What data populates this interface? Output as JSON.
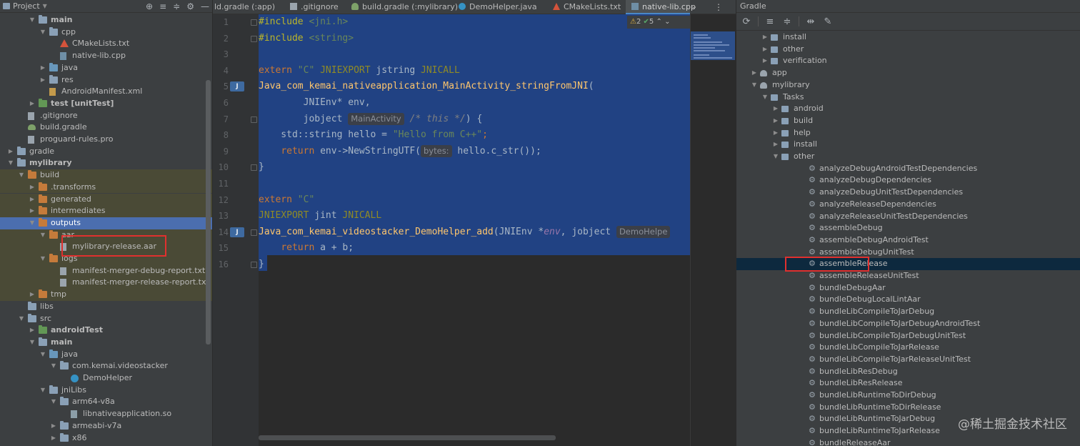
{
  "project_panel": {
    "title": "Project",
    "tools": [
      "target-icon",
      "expand-all-icon",
      "collapse-all-icon",
      "gear-icon",
      "hide-icon"
    ],
    "tree": [
      {
        "label": "main",
        "level": 3,
        "arrow": "down",
        "icon": "folder",
        "bold": true
      },
      {
        "label": "cpp",
        "level": 4,
        "arrow": "down",
        "icon": "folder"
      },
      {
        "label": "CMakeLists.txt",
        "level": 5,
        "arrow": "",
        "icon": "cmake"
      },
      {
        "label": "native-lib.cpp",
        "level": 5,
        "arrow": "",
        "icon": "cpp"
      },
      {
        "label": "java",
        "level": 4,
        "arrow": "right",
        "icon": "folder-blue"
      },
      {
        "label": "res",
        "level": 4,
        "arrow": "right",
        "icon": "folder"
      },
      {
        "label": "AndroidManifest.xml",
        "level": 4,
        "arrow": "",
        "icon": "xml"
      },
      {
        "label": "test [unitTest]",
        "level": 3,
        "arrow": "right",
        "icon": "folder-green",
        "bold": true
      },
      {
        "label": ".gitignore",
        "level": 2,
        "arrow": "",
        "icon": "doc"
      },
      {
        "label": "build.gradle",
        "level": 2,
        "arrow": "",
        "icon": "gradle"
      },
      {
        "label": "proguard-rules.pro",
        "level": 2,
        "arrow": "",
        "icon": "doc"
      },
      {
        "label": "gradle",
        "level": 1,
        "arrow": "right",
        "icon": "folder"
      },
      {
        "label": "mylibrary",
        "level": 1,
        "arrow": "down",
        "icon": "folder",
        "bold": true
      },
      {
        "label": "build",
        "level": 2,
        "arrow": "down",
        "icon": "folder-orange",
        "hl": "olive"
      },
      {
        "label": ".transforms",
        "level": 3,
        "arrow": "right",
        "icon": "folder-orange",
        "hl": "olive"
      },
      {
        "label": "generated",
        "level": 3,
        "arrow": "right",
        "icon": "folder-orange",
        "hl": "olive"
      },
      {
        "label": "intermediates",
        "level": 3,
        "arrow": "right",
        "icon": "folder-orange",
        "hl": "olive"
      },
      {
        "label": "outputs",
        "level": 3,
        "arrow": "down",
        "icon": "folder-orange",
        "hl": "selected"
      },
      {
        "label": "aar",
        "level": 4,
        "arrow": "down",
        "icon": "folder-orange",
        "hl": "olive"
      },
      {
        "label": "mylibrary-release.aar",
        "level": 5,
        "arrow": "",
        "icon": "aar",
        "hl": "olive"
      },
      {
        "label": "logs",
        "level": 4,
        "arrow": "down",
        "icon": "folder-orange",
        "hl": "olive"
      },
      {
        "label": "manifest-merger-debug-report.txt",
        "level": 5,
        "arrow": "",
        "icon": "doc",
        "hl": "olive"
      },
      {
        "label": "manifest-merger-release-report.txt",
        "level": 5,
        "arrow": "",
        "icon": "doc",
        "hl": "olive"
      },
      {
        "label": "tmp",
        "level": 3,
        "arrow": "right",
        "icon": "folder-orange",
        "hl": "olive"
      },
      {
        "label": "libs",
        "level": 2,
        "arrow": "",
        "icon": "folder"
      },
      {
        "label": "src",
        "level": 2,
        "arrow": "down",
        "icon": "folder"
      },
      {
        "label": "androidTest",
        "level": 3,
        "arrow": "right",
        "icon": "folder-green",
        "bold": true
      },
      {
        "label": "main",
        "level": 3,
        "arrow": "down",
        "icon": "folder",
        "bold": true
      },
      {
        "label": "java",
        "level": 4,
        "arrow": "down",
        "icon": "folder-blue"
      },
      {
        "label": "com.kemai.videostacker",
        "level": 5,
        "arrow": "down",
        "icon": "folder"
      },
      {
        "label": "DemoHelper",
        "level": 6,
        "arrow": "",
        "icon": "class"
      },
      {
        "label": "jniLibs",
        "level": 4,
        "arrow": "down",
        "icon": "folder"
      },
      {
        "label": "arm64-v8a",
        "level": 5,
        "arrow": "down",
        "icon": "folder"
      },
      {
        "label": "libnativeapplication.so",
        "level": 6,
        "arrow": "",
        "icon": "so"
      },
      {
        "label": "armeabi-v7a",
        "level": 5,
        "arrow": "right",
        "icon": "folder"
      },
      {
        "label": "x86",
        "level": 5,
        "arrow": "right",
        "icon": "folder"
      }
    ]
  },
  "editor": {
    "tabs": [
      {
        "label": "ld.gradle (:app)",
        "icon": "gradle",
        "active": false
      },
      {
        "label": ".gitignore",
        "icon": "git",
        "active": false
      },
      {
        "label": "build.gradle (:mylibrary)",
        "icon": "gradle",
        "active": false
      },
      {
        "label": "DemoHelper.java",
        "icon": "java",
        "active": false
      },
      {
        "label": "CMakeLists.txt",
        "icon": "cmake",
        "active": false
      },
      {
        "label": "native-lib.cpp",
        "icon": "cpp",
        "active": true
      }
    ],
    "tab_dropdown": "⌄",
    "tab_menu": "⋮",
    "inspection": {
      "warnings": "2",
      "ok": "5",
      "up": "⌃",
      "down": "⌄"
    },
    "line_numbers": [
      "1",
      "2",
      "3",
      "4",
      "5",
      "6",
      "7",
      "8",
      "9",
      "10",
      "11",
      "12",
      "13",
      "14",
      "15",
      "16"
    ],
    "gutter_icon_text": "J",
    "code": {
      "l1_a": "#include ",
      "l1_b": "<jni.h>",
      "l2_a": "#include ",
      "l2_b": "<string>",
      "l4_a": "extern ",
      "l4_b": "\"C\"",
      "l4_c": " JNIEXPORT ",
      "l4_d": "jstring ",
      "l4_e": "JNICALL",
      "l5_a": "Java_com_kemai_nativeapplication_MainActivity_stringFromJNI",
      "l5_b": "(",
      "l6_a": "        JNIEnv* env,",
      "l7_a": "        jobject ",
      "l7_hint": "MainActivity",
      "l7_b": " /* this */",
      "l7_c": ") {",
      "l8_a": "    std::string hello = ",
      "l8_b": "\"Hello from C++\"",
      "l8_c": ";",
      "l9_a": "    ",
      "l9_b": "return ",
      "l9_c": "env->NewStringUTF(",
      "l9_hint": "bytes:",
      "l9_d": " hello.c_str());",
      "l10_a": "}",
      "l12_a": "extern ",
      "l12_b": "\"C\"",
      "l13_a": "JNIEXPORT ",
      "l13_b": "jint ",
      "l13_c": "JNICALL",
      "l14_a": "Java_com_kemai_videostacker_DemoHelper_add",
      "l14_b": "(JNIEnv *",
      "l14_c": "env",
      "l14_d": ", jobject ",
      "l14_hint": "DemoHelpe",
      "l15_a": "    ",
      "l15_b": "return ",
      "l15_c": "a + b;",
      "l16_a": "}"
    }
  },
  "gradle_panel": {
    "title": "Gradle",
    "toolbar": [
      "refresh-icon",
      "expand-icon",
      "collapse-icon",
      "toggle-offline-icon",
      "settings-wrench-icon"
    ],
    "tree": [
      {
        "label": "install",
        "level": 2,
        "arrow": "right",
        "icon": "folder"
      },
      {
        "label": "other",
        "level": 2,
        "arrow": "right",
        "icon": "folder"
      },
      {
        "label": "verification",
        "level": 2,
        "arrow": "right",
        "icon": "folder"
      },
      {
        "label": "app",
        "level": 1,
        "arrow": "right",
        "icon": "elephant"
      },
      {
        "label": "mylibrary",
        "level": 1,
        "arrow": "down",
        "icon": "elephant"
      },
      {
        "label": "Tasks",
        "level": 2,
        "arrow": "down",
        "icon": "folder"
      },
      {
        "label": "android",
        "level": 3,
        "arrow": "right",
        "icon": "folder"
      },
      {
        "label": "build",
        "level": 3,
        "arrow": "right",
        "icon": "folder"
      },
      {
        "label": "help",
        "level": 3,
        "arrow": "right",
        "icon": "folder"
      },
      {
        "label": "install",
        "level": 3,
        "arrow": "right",
        "icon": "folder"
      },
      {
        "label": "other",
        "level": 3,
        "arrow": "down",
        "icon": "folder"
      },
      {
        "label": "analyzeDebugAndroidTestDependencies",
        "level": 4,
        "icon": "gear"
      },
      {
        "label": "analyzeDebugDependencies",
        "level": 4,
        "icon": "gear"
      },
      {
        "label": "analyzeDebugUnitTestDependencies",
        "level": 4,
        "icon": "gear"
      },
      {
        "label": "analyzeReleaseDependencies",
        "level": 4,
        "icon": "gear"
      },
      {
        "label": "analyzeReleaseUnitTestDependencies",
        "level": 4,
        "icon": "gear"
      },
      {
        "label": "assembleDebug",
        "level": 4,
        "icon": "gear"
      },
      {
        "label": "assembleDebugAndroidTest",
        "level": 4,
        "icon": "gear"
      },
      {
        "label": "assembleDebugUnitTest",
        "level": 4,
        "icon": "gear"
      },
      {
        "label": "assembleRelease",
        "level": 4,
        "icon": "gear",
        "selected": true
      },
      {
        "label": "assembleReleaseUnitTest",
        "level": 4,
        "icon": "gear"
      },
      {
        "label": "bundleDebugAar",
        "level": 4,
        "icon": "gear"
      },
      {
        "label": "bundleDebugLocalLintAar",
        "level": 4,
        "icon": "gear"
      },
      {
        "label": "bundleLibCompileToJarDebug",
        "level": 4,
        "icon": "gear"
      },
      {
        "label": "bundleLibCompileToJarDebugAndroidTest",
        "level": 4,
        "icon": "gear"
      },
      {
        "label": "bundleLibCompileToJarDebugUnitTest",
        "level": 4,
        "icon": "gear"
      },
      {
        "label": "bundleLibCompileToJarRelease",
        "level": 4,
        "icon": "gear"
      },
      {
        "label": "bundleLibCompileToJarReleaseUnitTest",
        "level": 4,
        "icon": "gear"
      },
      {
        "label": "bundleLibResDebug",
        "level": 4,
        "icon": "gear"
      },
      {
        "label": "bundleLibResRelease",
        "level": 4,
        "icon": "gear"
      },
      {
        "label": "bundleLibRuntimeToDirDebug",
        "level": 4,
        "icon": "gear"
      },
      {
        "label": "bundleLibRuntimeToDirRelease",
        "level": 4,
        "icon": "gear"
      },
      {
        "label": "bundleLibRuntimeToJarDebug",
        "level": 4,
        "icon": "gear"
      },
      {
        "label": "bundleLibRuntimeToJarRelease",
        "level": 4,
        "icon": "gear"
      },
      {
        "label": "bundleReleaseAar",
        "level": 4,
        "icon": "gear"
      }
    ]
  },
  "watermark": "@稀土掘金技术社区",
  "colors": {
    "selection": "#214283",
    "highlight_box": "#e0302e",
    "keyword": "#cc7832",
    "string": "#6a8759",
    "function": "#ffc66d"
  }
}
